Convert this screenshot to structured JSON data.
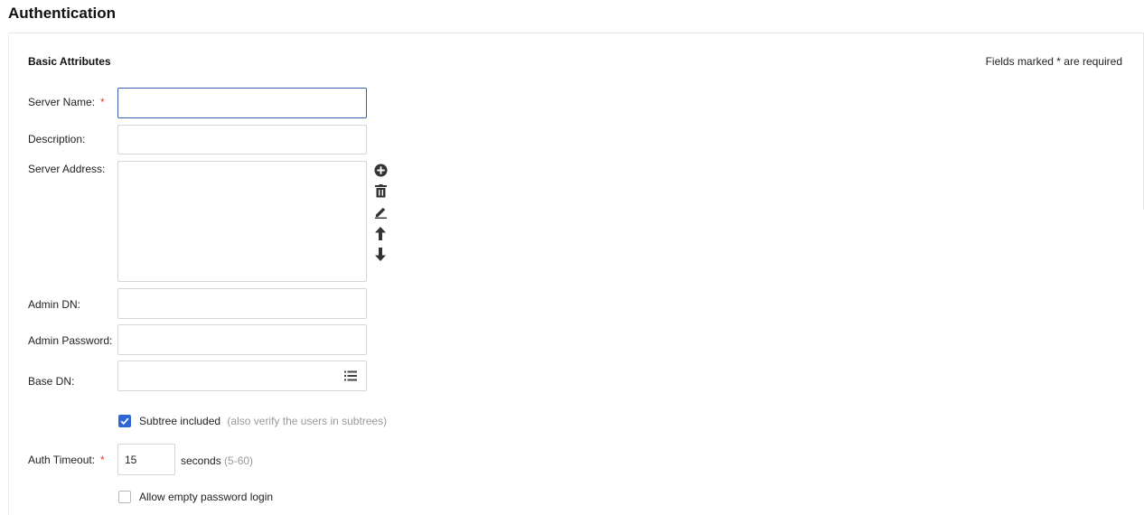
{
  "page": {
    "title": "Authentication"
  },
  "section": {
    "title": "Basic Attributes",
    "required_note": "Fields marked * are required"
  },
  "form": {
    "server_name": {
      "label": "Server Name:",
      "required": "*",
      "value": ""
    },
    "description": {
      "label": "Description:",
      "value": ""
    },
    "server_address": {
      "label": "Server Address:",
      "entries": [],
      "actions": [
        "add-icon",
        "delete-icon",
        "edit-icon",
        "move-up-icon",
        "move-down-icon"
      ]
    },
    "admin_dn": {
      "label": "Admin DN:",
      "value": ""
    },
    "admin_password": {
      "label": "Admin Password:",
      "value": ""
    },
    "base_dn": {
      "label": "Base DN:",
      "value": "",
      "browse_icon": "list-icon"
    },
    "subtree": {
      "label": "Subtree included",
      "hint": "(also verify the users in subtrees)",
      "checked": true
    },
    "auth_timeout": {
      "label": "Auth Timeout:",
      "required": "*",
      "value": "15",
      "unit": "seconds",
      "range": "(5-60)"
    },
    "allow_empty_password": {
      "label": "Allow empty password login",
      "checked": false
    }
  },
  "colors": {
    "required": "#e0402f",
    "checkbox_checked": "#2f67d6",
    "focus_border": "#3b5fb0",
    "hint": "#999999",
    "icon": "#333333"
  }
}
